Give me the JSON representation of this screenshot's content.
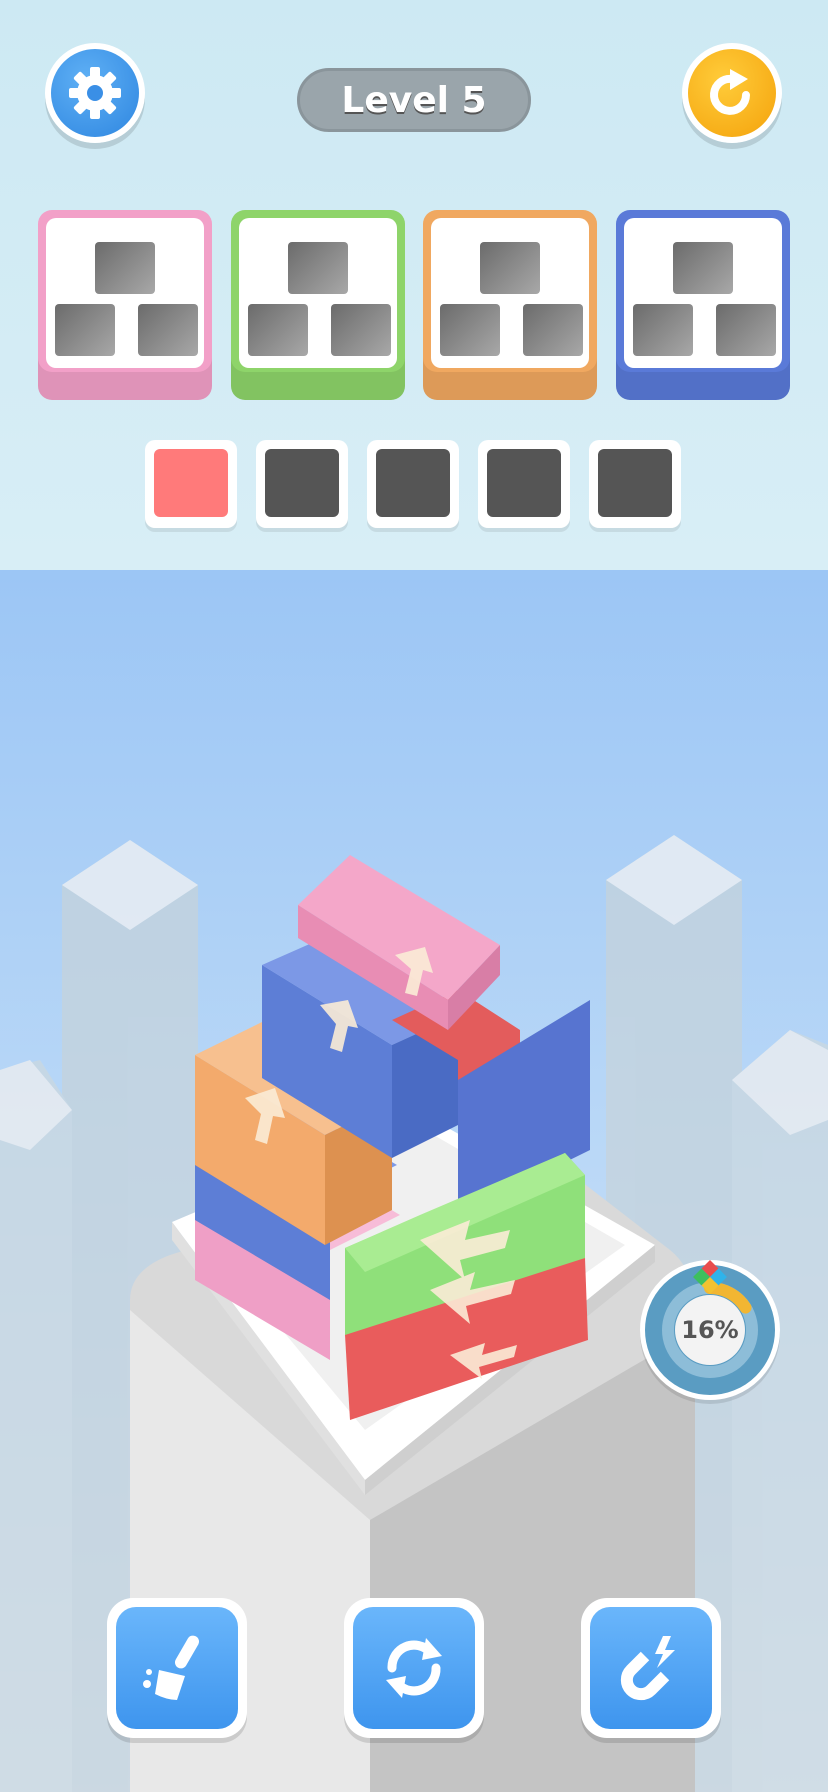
{
  "header": {
    "level_label": "Level 5",
    "settings_icon": "gear-icon",
    "restart_icon": "restart-arrow-icon"
  },
  "goal_cards": [
    {
      "color": "#f2a0c8",
      "slots": 3
    },
    {
      "color": "#8ed46a",
      "slots": 3
    },
    {
      "color": "#f0a860",
      "slots": 3
    },
    {
      "color": "#5a7ad8",
      "slots": 3
    }
  ],
  "tray": [
    {
      "fill": "#ff7a7a"
    },
    {
      "fill": "#555555"
    },
    {
      "fill": "#555555"
    },
    {
      "fill": "#555555"
    },
    {
      "fill": "#555555"
    }
  ],
  "progress": {
    "percent_label": "16%",
    "value": 0.16
  },
  "tools": [
    {
      "name": "broom-button",
      "icon": "broom-icon"
    },
    {
      "name": "shuffle-button",
      "icon": "shuffle-icon"
    },
    {
      "name": "magnet-button",
      "icon": "magnet-icon"
    }
  ]
}
